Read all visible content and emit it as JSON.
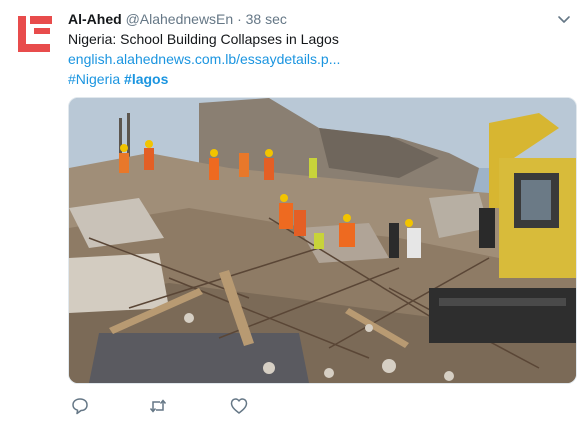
{
  "tweet": {
    "author_name": "Al-Ahed",
    "handle": "@AlahednewsEn",
    "separator": "·",
    "time": "38 sec",
    "text": "Nigeria: School Building Collapses in Lagos",
    "link": "english.alahednews.com.lb/essaydetails.p...",
    "hashtags": [
      "#Nigeria",
      "#lagos"
    ]
  },
  "icons": {
    "avatar": "alahed-logo",
    "caret": "chevron-down-icon",
    "reply": "reply-icon",
    "retweet": "retweet-icon",
    "like": "heart-icon"
  },
  "colors": {
    "link": "#1b95e0",
    "muted": "#657786",
    "text": "#14171a",
    "logo_red": "#e84c4c"
  }
}
